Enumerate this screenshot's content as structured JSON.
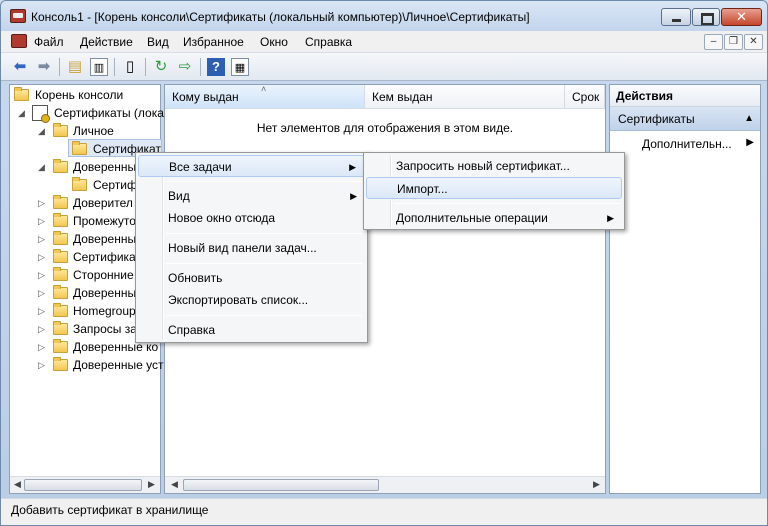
{
  "window": {
    "title": "Консоль1 - [Корень консоли\\Сертификаты (локальный компьютер)\\Личное\\Сертификаты]"
  },
  "menubar": {
    "items": [
      "Файл",
      "Действие",
      "Вид",
      "Избранное",
      "Окно",
      "Справка"
    ]
  },
  "toolbar": {
    "icons": [
      "back-arrow-icon",
      "forward-arrow-icon",
      "up-folder-icon",
      "show-hide-tree-icon",
      "properties-icon",
      "refresh-icon",
      "export-icon",
      "help-icon",
      "show-hide-action-pane-icon"
    ]
  },
  "tree": {
    "root": "Корень консоли",
    "certs_node": "Сертификаты (лока",
    "personal": "Личное",
    "personal_certs": "Сертификат",
    "trusted_root": "Доверенны",
    "trusted_root_certs": "Сертиф",
    "nodes": [
      "Доверител",
      "Промежуто",
      "Доверенны",
      "Сертифика",
      "Сторонние",
      "Доверенны",
      "Homegroup",
      "Запросы за",
      "Доверенные ко",
      "Доверенные уст"
    ]
  },
  "columns": {
    "issued_to": "Кому выдан",
    "issued_by": "Кем выдан",
    "expiry": "Срок"
  },
  "center": {
    "empty_message": "Нет элементов для отображения в этом виде."
  },
  "actions": {
    "header": "Действия",
    "section": "Сертификаты",
    "more": "Дополнительн..."
  },
  "context_menu": {
    "all_tasks": "Все задачи",
    "view": "Вид",
    "new_window": "Новое окно отсюда",
    "new_taskpad": "Новый вид панели задач...",
    "refresh": "Обновить",
    "export_list": "Экспортировать список...",
    "help": "Справка"
  },
  "submenu": {
    "request_new": "Запросить новый сертификат...",
    "import": "Импорт...",
    "advanced": "Дополнительные операции"
  },
  "status": {
    "text": "Добавить сертификат в хранилище"
  }
}
